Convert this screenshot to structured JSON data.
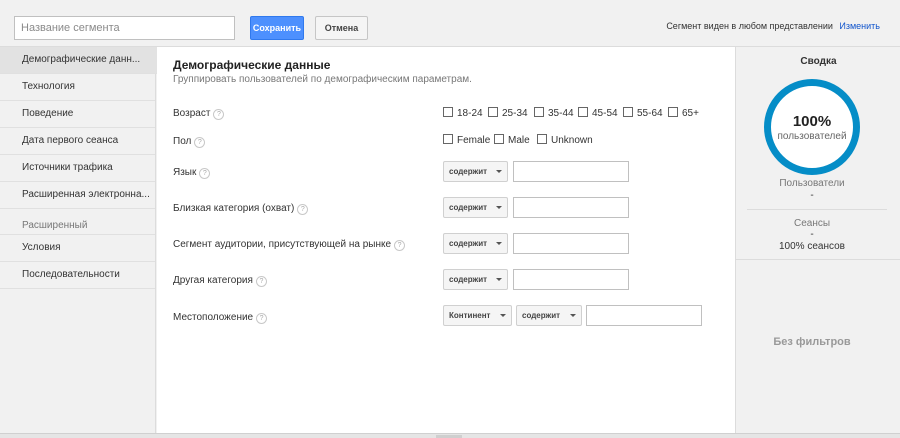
{
  "topbar": {
    "segment_placeholder": "Название сегмента",
    "save_label": "Сохранить",
    "cancel_label": "Отмена",
    "visibility_text": "Сегмент виден в любом представлении",
    "change_link": "Изменить"
  },
  "sidebar": {
    "items": [
      {
        "label": "Демографические данн..."
      },
      {
        "label": "Технология"
      },
      {
        "label": "Поведение"
      },
      {
        "label": "Дата первого сеанса"
      },
      {
        "label": "Источники трафика"
      },
      {
        "label": "Расширенная электронна..."
      }
    ],
    "group_label": "Расширенный",
    "advanced_items": [
      {
        "label": "Условия"
      },
      {
        "label": "Последовательности"
      }
    ]
  },
  "main": {
    "title": "Демографические данные",
    "subtitle": "Группировать пользователей по демографическим параметрам.",
    "age": {
      "label": "Возраст",
      "options": [
        "18-24",
        "25-34",
        "35-44",
        "45-54",
        "55-64",
        "65+"
      ]
    },
    "gender": {
      "label": "Пол",
      "options": [
        "Female",
        "Male",
        "Unknown"
      ]
    },
    "language": {
      "label": "Язык",
      "operator": "содержит",
      "value": ""
    },
    "affinity": {
      "label": "Близкая категория (охват)",
      "operator": "содержит",
      "value": ""
    },
    "in_market": {
      "label": "Сегмент аудитории, присутствующей на рынке",
      "operator": "содержит",
      "value": ""
    },
    "other_category": {
      "label": "Другая категория",
      "operator": "содержит",
      "value": ""
    },
    "location": {
      "label": "Местоположение",
      "scope": "Континент",
      "operator": "содержит",
      "value": ""
    },
    "help_glyph": "?"
  },
  "summary": {
    "title": "Сводка",
    "donut_value": "100%",
    "donut_label": "пользователей",
    "donut_fraction": 1.0,
    "users_label": "Пользователи",
    "users_value": "-",
    "sessions_label": "Сеансы",
    "sessions_value": "-",
    "sessions_pct": "100% сеансов",
    "no_filters": "Без фильтров",
    "accent_color": "#058dc7"
  }
}
